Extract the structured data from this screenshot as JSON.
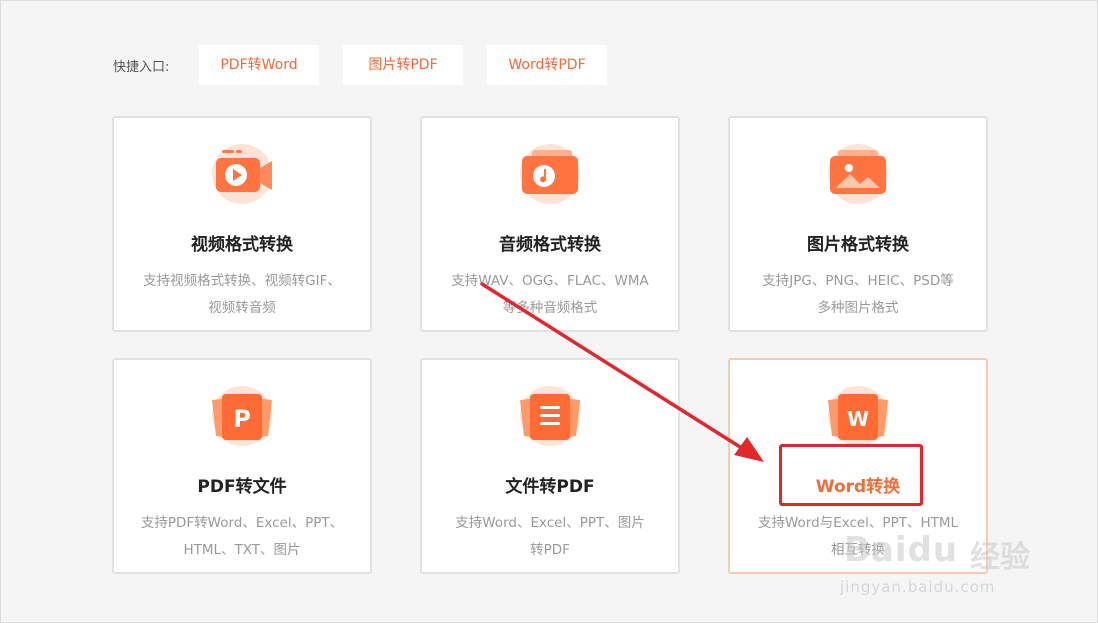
{
  "quick_entry": {
    "label": "快捷入口:",
    "buttons": [
      "PDF转Word",
      "图片转PDF",
      "Word转PDF"
    ]
  },
  "cards": [
    {
      "icon": "video-icon",
      "title": "视频格式转换",
      "desc": [
        "支持视频格式转换、视频转GIF、",
        "视频转音频"
      ]
    },
    {
      "icon": "audio-icon",
      "title": "音频格式转换",
      "desc": [
        "支持WAV、OGG、FLAC、WMA",
        "等多种音频格式"
      ]
    },
    {
      "icon": "image-icon",
      "title": "图片格式转换",
      "desc": [
        "支持JPG、PNG、HEIC、PSD等",
        "多种图片格式"
      ]
    },
    {
      "icon": "pdf-file-icon",
      "title": "PDF转文件",
      "desc": [
        "支持PDF转Word、Excel、PPT、",
        "HTML、TXT、图片"
      ]
    },
    {
      "icon": "document-icon",
      "title": "文件转PDF",
      "desc": [
        "支持Word、Excel、PPT、图片",
        "转PDF"
      ]
    },
    {
      "icon": "word-icon",
      "title": "Word转换",
      "desc": [
        "支持Word与Excel、PPT、HTML",
        "相互转换"
      ],
      "active": true
    }
  ],
  "colors": {
    "accent": "#f26c3a",
    "accent_light": "#ff9a6a",
    "annotation": "#e3262c"
  },
  "watermark": {
    "brand_latin": "Baidu",
    "brand_cn": "经验",
    "url": "jingyan.baidu.com"
  }
}
